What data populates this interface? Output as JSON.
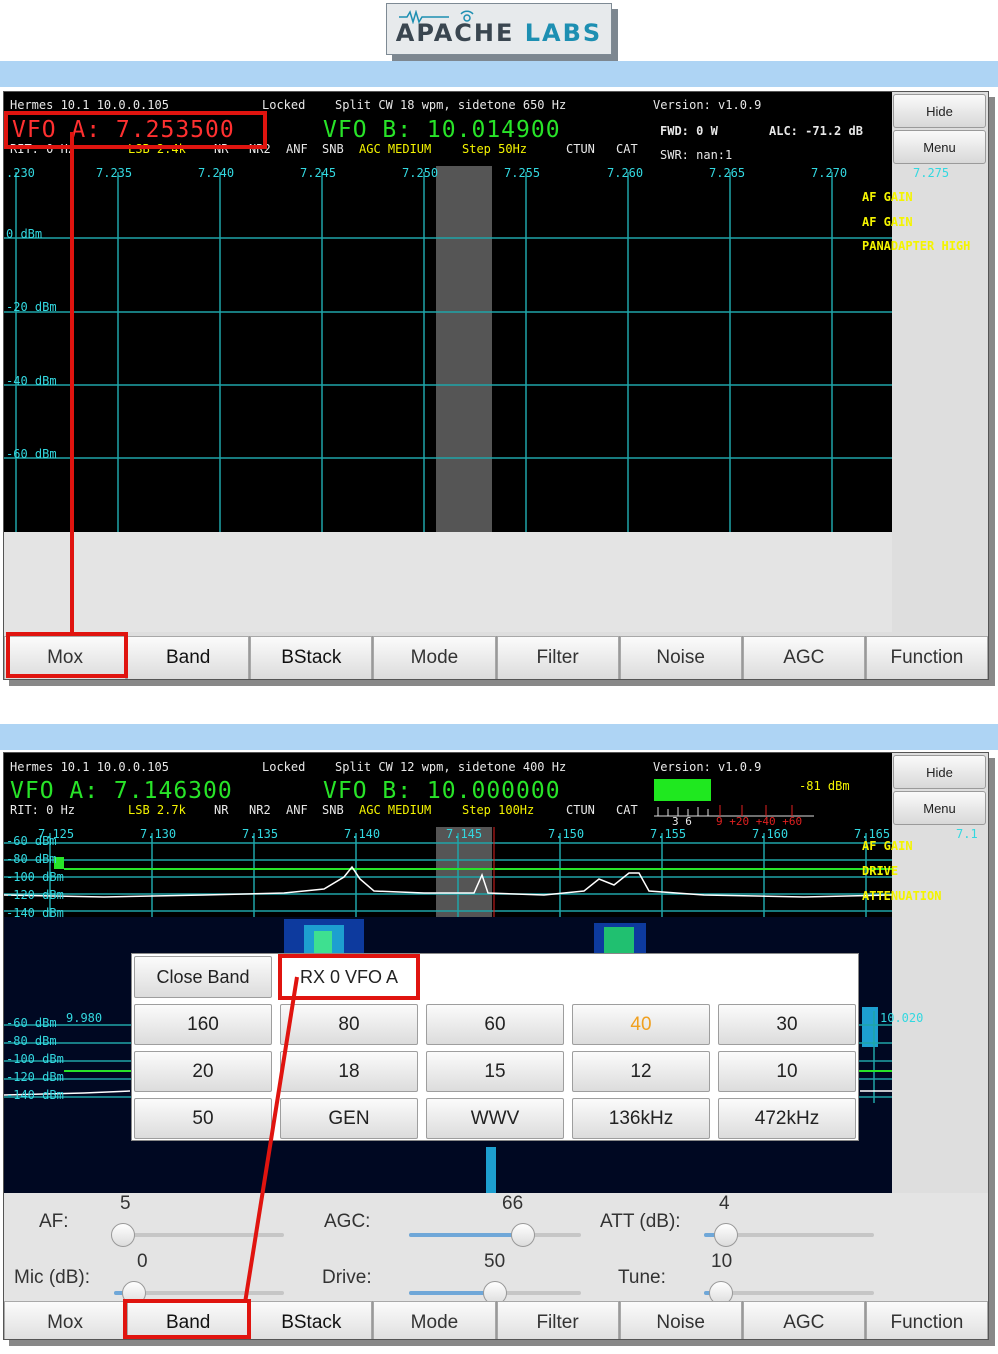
{
  "logo": {
    "prefix": "APACHE",
    "suffix": " LABS"
  },
  "colors": {
    "accent": "#28e428",
    "status_yellow": "#f4f400",
    "axis_cyan": "#33d8e0",
    "highlight_red": "#e0140f",
    "band_active": "#f0a020"
  },
  "s1": {
    "status": {
      "radio": "Hermes 10.1 10.0.0.105",
      "lock": "Locked",
      "cw": "Split CW 18 wpm, sidetone 650 Hz",
      "version": "Version: v1.0.9"
    },
    "vfo_a": "VFO A: 7.253500",
    "vfo_b": "VFO B: 10.014900",
    "fwd": "FWD: 0 W",
    "alc": "ALC: -71.2 dB",
    "swr": "SWR: nan:1",
    "rit": "RIT: 0 Hz",
    "mode": "LSB 2.4k",
    "flags": [
      "NR",
      "NR2",
      "ANF",
      "SNB"
    ],
    "agc": "AGC MEDIUM",
    "step": "Step 50Hz",
    "ctun": "CTUN",
    "cat": "CAT",
    "freqs": [
      ".230",
      "7.235",
      "7.240",
      "7.245",
      "7.250",
      "7.255",
      "7.260",
      "7.265",
      "7.270",
      "7.275"
    ],
    "dbm": [
      "0 dBm",
      "-20 dBm",
      "-40 dBm",
      "-60 dBm"
    ],
    "overlay": [
      "AF GAIN",
      "AF GAIN",
      "PANADAPTER HIGH"
    ],
    "hide": "Hide",
    "menu": "Menu",
    "tabs": [
      "Mox",
      "Band",
      "BStack",
      "Mode",
      "Filter",
      "Noise",
      "AGC",
      "Function"
    ]
  },
  "s2": {
    "status": {
      "radio": "Hermes 10.1 10.0.0.105",
      "lock": "Locked",
      "cw": "Split CW 12 wpm, sidetone 400 Hz",
      "version": "Version: v1.0.9"
    },
    "vfo_a": "VFO A: 7.146300",
    "vfo_b": "VFO B: 10.000000",
    "meter_dbm": "-81 dBm",
    "meter_scale_white": "3  6",
    "meter_scale_red": "9 +20 +40 +60",
    "rit": "RIT: 0 Hz",
    "mode": "LSB 2.7k",
    "flags": [
      "NR",
      "NR2",
      "ANF",
      "SNB"
    ],
    "agc": "AGC MEDIUM",
    "step": "Step 100Hz",
    "ctun": "CTUN",
    "cat": "CAT",
    "freqs": [
      "7.125",
      "7.130",
      "7.135",
      "7.140",
      "7.145",
      "7.150",
      "7.155",
      "7.160",
      "7.165",
      "7.1"
    ],
    "dbm": [
      "-60 dBm",
      "-80 dBm",
      "-100 dBm",
      "-120 dBm",
      "-140 dBm"
    ],
    "overlay": [
      "AF GAIN",
      "DRIVE",
      "ATTENUATION"
    ],
    "sub_freqs": [
      "9.980",
      "10.020"
    ],
    "dbm2": [
      "-60 dBm",
      "-80 dBm",
      "-100 dBm",
      "-120 dBm",
      "-140 dBm"
    ],
    "hide": "Hide",
    "menu": "Menu",
    "popup": {
      "close": "Close Band",
      "rx": "RX 0 VFO A",
      "bands": [
        "160",
        "80",
        "60",
        "40",
        "30",
        "20",
        "18",
        "15",
        "12",
        "10",
        "50",
        "GEN",
        "WWV",
        "136kHz",
        "472kHz"
      ],
      "active": "40"
    },
    "sliders": [
      {
        "label": "AF:",
        "value": "5",
        "fraction": 0.05
      },
      {
        "label": "AGC:",
        "value": "66",
        "fraction": 0.66
      },
      {
        "label": "ATT (dB):",
        "value": "4",
        "fraction": 0.13
      },
      {
        "label": "Mic (dB):",
        "value": "0",
        "fraction": 0.12
      },
      {
        "label": "Drive:",
        "value": "50",
        "fraction": 0.5
      },
      {
        "label": "Tune:",
        "value": "10",
        "fraction": 0.1
      }
    ],
    "tabs": [
      "Mox",
      "Band",
      "BStack",
      "Mode",
      "Filter",
      "Noise",
      "AGC",
      "Function"
    ]
  }
}
